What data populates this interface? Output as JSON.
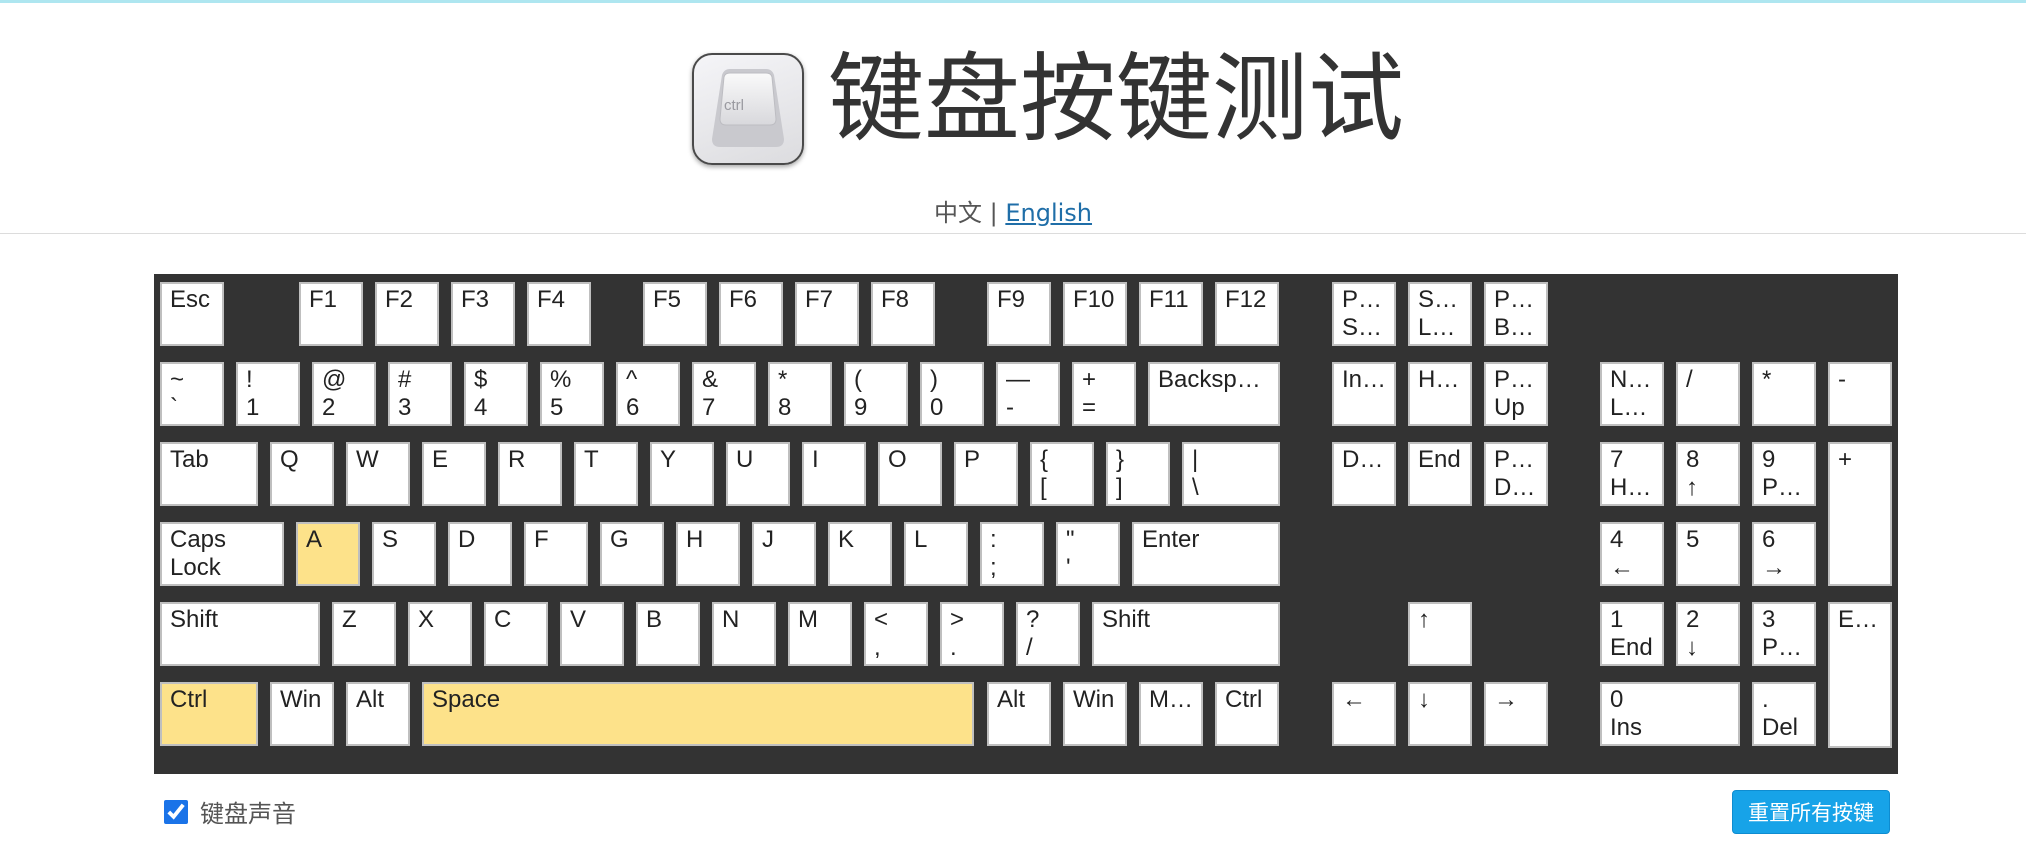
{
  "header": {
    "title": "键盘按键测试",
    "logo_text": "ctrl",
    "lang_current": "中文",
    "lang_separator": "|",
    "lang_english": "English"
  },
  "keyboard": {
    "keys": [
      {
        "id": "esc",
        "l1": "Esc",
        "l2": "",
        "on": false
      },
      {
        "id": "f1",
        "l1": "F1",
        "l2": "",
        "on": false
      },
      {
        "id": "f2",
        "l1": "F2",
        "l2": "",
        "on": false
      },
      {
        "id": "f3",
        "l1": "F3",
        "l2": "",
        "on": false
      },
      {
        "id": "f4",
        "l1": "F4",
        "l2": "",
        "on": false
      },
      {
        "id": "f5",
        "l1": "F5",
        "l2": "",
        "on": false
      },
      {
        "id": "f6",
        "l1": "F6",
        "l2": "",
        "on": false
      },
      {
        "id": "f7",
        "l1": "F7",
        "l2": "",
        "on": false
      },
      {
        "id": "f8",
        "l1": "F8",
        "l2": "",
        "on": false
      },
      {
        "id": "f9",
        "l1": "F9",
        "l2": "",
        "on": false
      },
      {
        "id": "f10",
        "l1": "F10",
        "l2": "",
        "on": false
      },
      {
        "id": "f11",
        "l1": "F11",
        "l2": "",
        "on": false
      },
      {
        "id": "f12",
        "l1": "F12",
        "l2": "",
        "on": false
      },
      {
        "id": "printscrn",
        "l1": "Print",
        "l2": "Scrn",
        "on": false
      },
      {
        "id": "scrolllock",
        "l1": "S…",
        "l2": "Lock",
        "on": false
      },
      {
        "id": "pausebreak",
        "l1": "P…",
        "l2": "Br…",
        "on": false
      },
      {
        "id": "backtick",
        "l1": "~",
        "l2": "`",
        "on": false
      },
      {
        "id": "d1",
        "l1": "!",
        "l2": "1",
        "on": false
      },
      {
        "id": "d2",
        "l1": "@",
        "l2": "2",
        "on": false
      },
      {
        "id": "d3",
        "l1": "#",
        "l2": "3",
        "on": false
      },
      {
        "id": "d4",
        "l1": "$",
        "l2": "4",
        "on": false
      },
      {
        "id": "d5",
        "l1": "%",
        "l2": "5",
        "on": false
      },
      {
        "id": "d6",
        "l1": "^",
        "l2": "6",
        "on": false
      },
      {
        "id": "d7",
        "l1": "&",
        "l2": "7",
        "on": false
      },
      {
        "id": "d8",
        "l1": "*",
        "l2": "8",
        "on": false
      },
      {
        "id": "d9",
        "l1": "(",
        "l2": "9",
        "on": false
      },
      {
        "id": "d0",
        "l1": ")",
        "l2": "0",
        "on": false
      },
      {
        "id": "minus",
        "l1": "—",
        "l2": "-",
        "on": false
      },
      {
        "id": "equal",
        "l1": "+",
        "l2": "=",
        "on": false
      },
      {
        "id": "backspace",
        "l1": "Backspace",
        "l2": "",
        "on": false
      },
      {
        "id": "insert",
        "l1": "In…",
        "l2": "",
        "on": false
      },
      {
        "id": "home",
        "l1": "H…",
        "l2": "",
        "on": false
      },
      {
        "id": "pageup",
        "l1": "P…",
        "l2": "Up",
        "on": false
      },
      {
        "id": "numlock",
        "l1": "Num",
        "l2": "Lock",
        "on": false
      },
      {
        "id": "numdiv",
        "l1": "/",
        "l2": "",
        "on": false
      },
      {
        "id": "nummul",
        "l1": "*",
        "l2": "",
        "on": false
      },
      {
        "id": "numsub",
        "l1": "-",
        "l2": "",
        "on": false
      },
      {
        "id": "tab",
        "l1": "Tab",
        "l2": "",
        "on": false
      },
      {
        "id": "q",
        "l1": "Q",
        "l2": "",
        "on": false
      },
      {
        "id": "w",
        "l1": "W",
        "l2": "",
        "on": false
      },
      {
        "id": "e",
        "l1": "E",
        "l2": "",
        "on": false
      },
      {
        "id": "r",
        "l1": "R",
        "l2": "",
        "on": false
      },
      {
        "id": "t",
        "l1": "T",
        "l2": "",
        "on": false
      },
      {
        "id": "y",
        "l1": "Y",
        "l2": "",
        "on": false
      },
      {
        "id": "u",
        "l1": "U",
        "l2": "",
        "on": false
      },
      {
        "id": "i",
        "l1": "I",
        "l2": "",
        "on": false
      },
      {
        "id": "o",
        "l1": "O",
        "l2": "",
        "on": false
      },
      {
        "id": "p",
        "l1": "P",
        "l2": "",
        "on": false
      },
      {
        "id": "lbracket",
        "l1": "{",
        "l2": "[",
        "on": false
      },
      {
        "id": "rbracket",
        "l1": "}",
        "l2": "]",
        "on": false
      },
      {
        "id": "backslash",
        "l1": "|",
        "l2": "\\",
        "on": false
      },
      {
        "id": "delete",
        "l1": "D…",
        "l2": "",
        "on": false
      },
      {
        "id": "end",
        "l1": "End",
        "l2": "",
        "on": false
      },
      {
        "id": "pagedown",
        "l1": "P…",
        "l2": "D…",
        "on": false
      },
      {
        "id": "num7",
        "l1": "7",
        "l2": "H…",
        "on": false
      },
      {
        "id": "num8",
        "l1": "8",
        "l2": "↑",
        "on": false
      },
      {
        "id": "num9",
        "l1": "9",
        "l2": "P…",
        "on": false
      },
      {
        "id": "numadd",
        "l1": "+",
        "l2": "",
        "on": false
      },
      {
        "id": "capslock",
        "l1": "Caps",
        "l2": "Lock",
        "on": false
      },
      {
        "id": "a",
        "l1": "A",
        "l2": "",
        "on": true
      },
      {
        "id": "s",
        "l1": "S",
        "l2": "",
        "on": false
      },
      {
        "id": "d",
        "l1": "D",
        "l2": "",
        "on": false
      },
      {
        "id": "f",
        "l1": "F",
        "l2": "",
        "on": false
      },
      {
        "id": "g",
        "l1": "G",
        "l2": "",
        "on": false
      },
      {
        "id": "h",
        "l1": "H",
        "l2": "",
        "on": false
      },
      {
        "id": "j",
        "l1": "J",
        "l2": "",
        "on": false
      },
      {
        "id": "k",
        "l1": "K",
        "l2": "",
        "on": false
      },
      {
        "id": "l",
        "l1": "L",
        "l2": "",
        "on": false
      },
      {
        "id": "semicolon",
        "l1": ":",
        "l2": ";",
        "on": false
      },
      {
        "id": "quote",
        "l1": "\"",
        "l2": "'",
        "on": false
      },
      {
        "id": "enter",
        "l1": "Enter",
        "l2": "",
        "on": false
      },
      {
        "id": "num4",
        "l1": "4",
        "l2": "←",
        "on": false
      },
      {
        "id": "num5",
        "l1": "5",
        "l2": "",
        "on": false
      },
      {
        "id": "num6",
        "l1": "6",
        "l2": "→",
        "on": false
      },
      {
        "id": "lshift",
        "l1": "Shift",
        "l2": "",
        "on": false
      },
      {
        "id": "z",
        "l1": "Z",
        "l2": "",
        "on": false
      },
      {
        "id": "x",
        "l1": "X",
        "l2": "",
        "on": false
      },
      {
        "id": "c",
        "l1": "C",
        "l2": "",
        "on": false
      },
      {
        "id": "v",
        "l1": "V",
        "l2": "",
        "on": false
      },
      {
        "id": "b",
        "l1": "B",
        "l2": "",
        "on": false
      },
      {
        "id": "n",
        "l1": "N",
        "l2": "",
        "on": false
      },
      {
        "id": "m",
        "l1": "M",
        "l2": "",
        "on": false
      },
      {
        "id": "comma",
        "l1": "<",
        "l2": ",",
        "on": false
      },
      {
        "id": "period",
        "l1": ">",
        "l2": ".",
        "on": false
      },
      {
        "id": "slash",
        "l1": "?",
        "l2": "/",
        "on": false
      },
      {
        "id": "rshift",
        "l1": "Shift",
        "l2": "",
        "on": false
      },
      {
        "id": "up",
        "l1": "↑",
        "l2": "",
        "on": false
      },
      {
        "id": "num1",
        "l1": "1",
        "l2": "End",
        "on": false
      },
      {
        "id": "num2",
        "l1": "2",
        "l2": "↓",
        "on": false
      },
      {
        "id": "num3",
        "l1": "3",
        "l2": "P…",
        "on": false
      },
      {
        "id": "numenter",
        "l1": "E…",
        "l2": "",
        "on": false
      },
      {
        "id": "lctrl",
        "l1": "Ctrl",
        "l2": "",
        "on": true
      },
      {
        "id": "lwin",
        "l1": "Win",
        "l2": "",
        "on": false
      },
      {
        "id": "lalt",
        "l1": "Alt",
        "l2": "",
        "on": false
      },
      {
        "id": "space",
        "l1": "Space",
        "l2": "",
        "on": true
      },
      {
        "id": "ralt",
        "l1": "Alt",
        "l2": "",
        "on": false
      },
      {
        "id": "rwin",
        "l1": "Win",
        "l2": "",
        "on": false
      },
      {
        "id": "menu",
        "l1": "M…",
        "l2": "",
        "on": false
      },
      {
        "id": "rctrl",
        "l1": "Ctrl",
        "l2": "",
        "on": false
      },
      {
        "id": "left",
        "l1": "←",
        "l2": "",
        "on": false
      },
      {
        "id": "down",
        "l1": "↓",
        "l2": "",
        "on": false
      },
      {
        "id": "right",
        "l1": "→",
        "l2": "",
        "on": false
      },
      {
        "id": "num0",
        "l1": "0",
        "l2": "Ins",
        "on": false
      },
      {
        "id": "numdot",
        "l1": ".",
        "l2": "Del",
        "on": false
      }
    ]
  },
  "footer": {
    "sound_label": "键盘声音",
    "sound_checked": true,
    "reset_label": "重置所有按键"
  },
  "colors": {
    "keyboard_bg": "#333333",
    "key_bg": "#ffffff",
    "key_pressed": "#fde28a",
    "reset_button": "#17a3e8",
    "link": "#1f6ea8"
  }
}
